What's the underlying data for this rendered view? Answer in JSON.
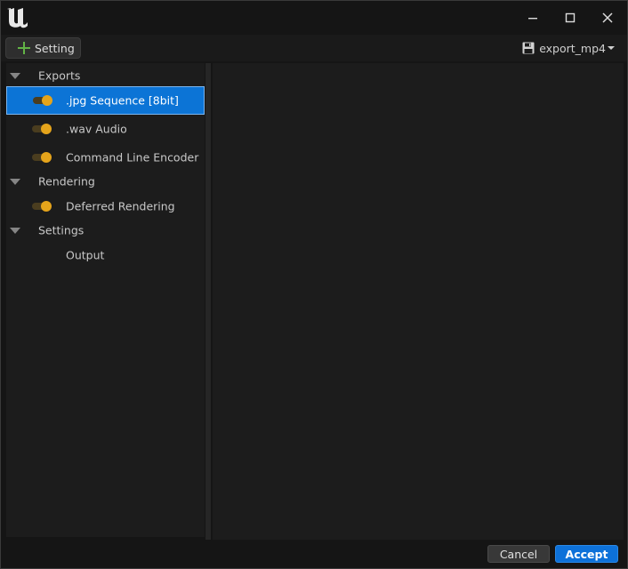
{
  "titlebar": {
    "logo_icon": "unreal-engine-logo-icon",
    "minimize_icon": "minimize-icon",
    "maximize_icon": "maximize-icon",
    "close_icon": "close-icon"
  },
  "toolbar": {
    "add_label": "Setting",
    "add_icon": "plus-icon",
    "preset_name": "export_mp4",
    "preset_icon": "save-icon"
  },
  "tree": {
    "groups": [
      {
        "label": "Exports",
        "items": [
          {
            "label": ".jpg Sequence [8bit]",
            "toggle": true,
            "selected": true
          },
          {
            "label": ".wav Audio",
            "toggle": true,
            "selected": false
          },
          {
            "label": "Command Line Encoder",
            "toggle": true,
            "selected": false
          }
        ]
      },
      {
        "label": "Rendering",
        "items": [
          {
            "label": "Deferred Rendering",
            "toggle": true,
            "selected": false
          }
        ]
      },
      {
        "label": "Settings",
        "items": [
          {
            "label": "Output",
            "toggle": false,
            "selected": false
          }
        ]
      }
    ]
  },
  "footer": {
    "cancel_label": "Cancel",
    "accept_label": "Accept"
  },
  "colors": {
    "accent": "#0c74d6",
    "toggle_on": "#e5a41b",
    "add_green": "#62b346"
  }
}
